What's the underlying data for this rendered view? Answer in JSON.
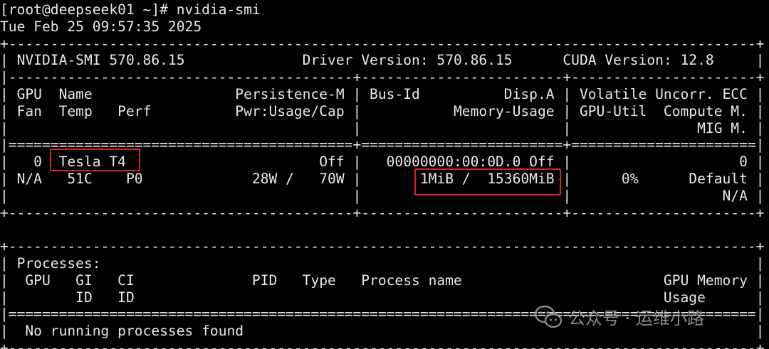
{
  "terminal": {
    "lines": [
      "[root@deepseek01 ~]# nvidia-smi",
      "Tue Feb 25 09:57:35 2025",
      "+-----------------------------------------------------------------------------------------+",
      "| NVIDIA-SMI 570.86.15              Driver Version: 570.86.15      CUDA Version: 12.8     |",
      "|-----------------------------------------+------------------------+----------------------+",
      "| GPU  Name                 Persistence-M | Bus-Id          Disp.A | Volatile Uncorr. ECC |",
      "| Fan  Temp   Perf          Pwr:Usage/Cap |           Memory-Usage | GPU-Util  Compute M. |",
      "|                                         |                        |               MIG M. |",
      "|=========================================+========================+======================|",
      "|   0  Tesla T4                       Off |   00000000:00:0D.0 Off |                    0 |",
      "| N/A   51C    P0             28W /   70W |       1MiB /  15360MiB |      0%      Default |",
      "|                                         |                        |                  N/A |",
      "+-----------------------------------------+------------------------+----------------------+",
      "",
      "+-----------------------------------------------------------------------------------------+",
      "| Processes:                                                                              |",
      "|  GPU   GI   CI              PID   Type   Process name                        GPU Memory |",
      "|        ID   ID                                                               Usage      |",
      "|=========================================================================================|",
      "|  No running processes found                                                             |",
      "+-----------------------------------------------------------------------------------------+"
    ]
  },
  "highlights": {
    "gpu_name": "Tesla T4",
    "memory_usage": "1MiB /  15360MiB",
    "color": "#e02020"
  },
  "watermark": {
    "text": "公众号 · 运维小路",
    "icon": "wechat-icon"
  }
}
